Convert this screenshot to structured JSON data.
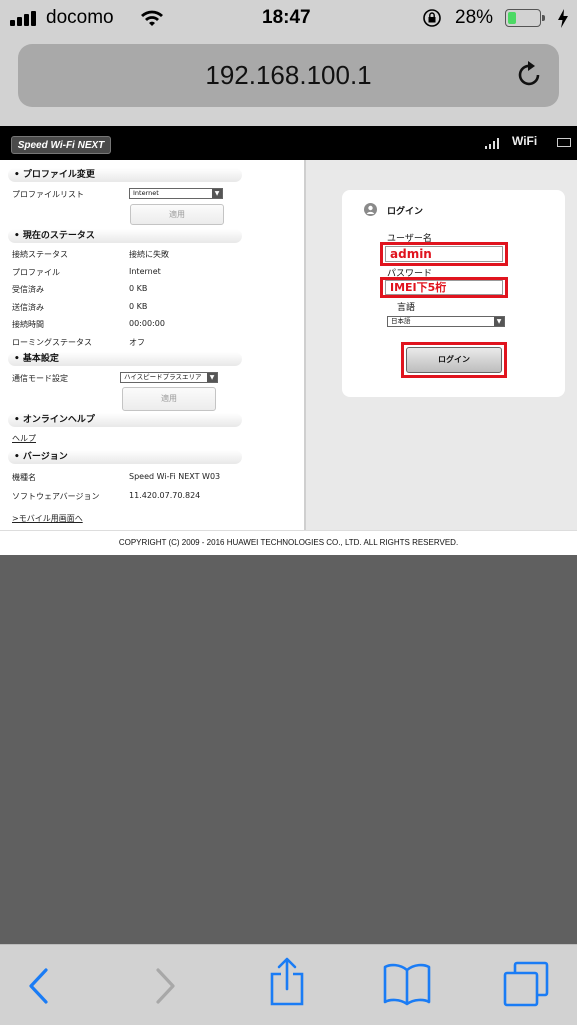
{
  "status": {
    "carrier": "docomo",
    "time": "18:47",
    "battery_percent": "28%",
    "battery_level": 0.28,
    "battery_color": "#4cd964"
  },
  "browser": {
    "url": "192.168.100.1",
    "reload_icon": "reload-icon",
    "toolbar_icons": [
      "back-icon",
      "forward-icon",
      "share-icon",
      "bookmarks-icon",
      "tabs-icon"
    ]
  },
  "router": {
    "logo": "Speed Wi-Fi NEXT",
    "wifi_label": "WiFi",
    "profile_section": {
      "title": "プロファイル変更",
      "list_label": "プロファイルリスト",
      "list_value": "Internet",
      "apply": "適用"
    },
    "status_section": {
      "title": "現在のステータス",
      "rows": [
        {
          "label": "接続ステータス",
          "value": "接続に失敗"
        },
        {
          "label": "プロファイル",
          "value": "Internet"
        },
        {
          "label": "受信済み",
          "value": "0 KB"
        },
        {
          "label": "送信済み",
          "value": "0 KB"
        },
        {
          "label": "接続時間",
          "value": "00:00:00"
        },
        {
          "label": "ローミングステータス",
          "value": "オフ"
        }
      ]
    },
    "basic_section": {
      "title": "基本設定",
      "mode_label": "通信モード設定",
      "mode_value": "ハイスピードプラスエリア",
      "apply": "適用"
    },
    "help_section": {
      "title": "オンラインヘルプ",
      "link": "ヘルプ"
    },
    "version_section": {
      "title": "バージョン",
      "rows": [
        {
          "label": "機種名",
          "value": "Speed Wi-Fi NEXT W03"
        },
        {
          "label": "ソフトウェアバージョン",
          "value": "11.420.07.70.824"
        }
      ]
    },
    "mobile_link": ">モバイル用画面へ",
    "login": {
      "title": "ログイン",
      "username_label": "ユーザー名",
      "username_value": "admin",
      "password_label": "パスワード",
      "password_value": "IMEI下5桁",
      "language_label": "言語",
      "language_value": "日本語",
      "button": "ログイン",
      "highlight_color": "#e0141e"
    },
    "copyright": "COPYRIGHT (C) 2009 - 2016 HUAWEI TECHNOLOGIES CO., LTD. ALL RIGHTS RESERVED."
  }
}
